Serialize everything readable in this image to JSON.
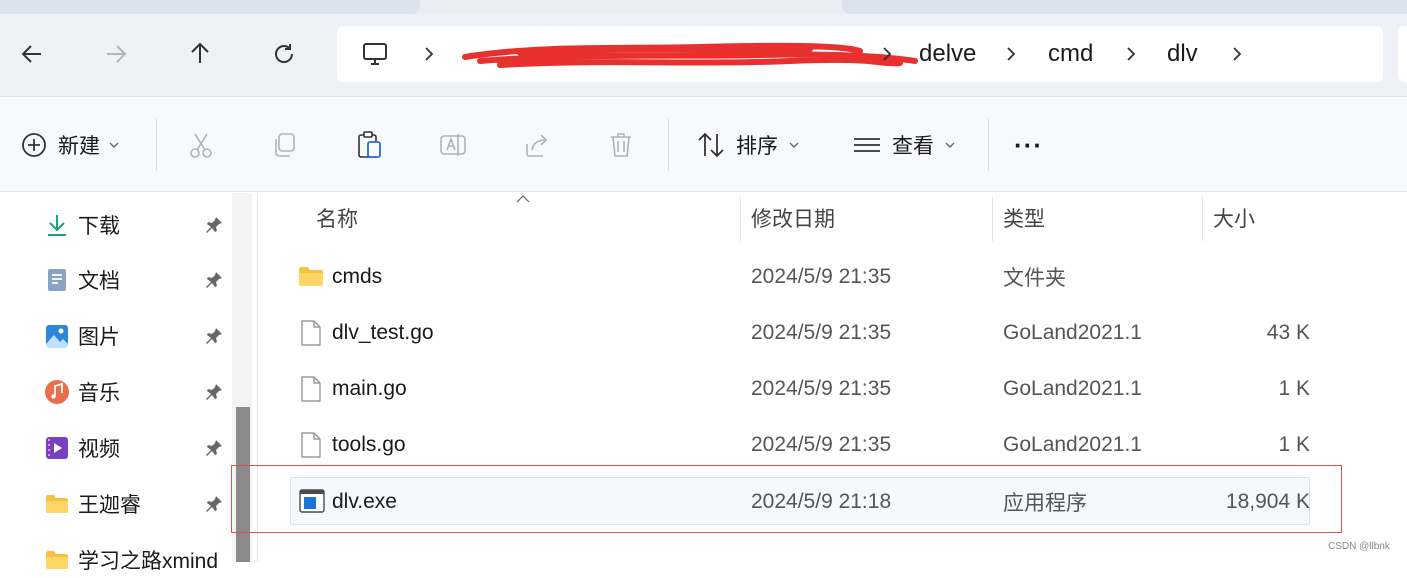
{
  "nav": {
    "back_icon": "arrow-left-icon",
    "forward_icon": "arrow-right-icon",
    "up_icon": "arrow-up-icon",
    "refresh_icon": "refresh-icon",
    "computer_icon": "monitor-icon",
    "ellipsis": "···",
    "breadcrumbs": [
      "delve",
      "cmd",
      "dlv"
    ]
  },
  "commands": {
    "new_label": "新建",
    "sort_label": "排序",
    "view_label": "查看",
    "more_label": "···"
  },
  "sidebar": {
    "items": [
      {
        "label": "下载",
        "icon": "download-icon"
      },
      {
        "label": "文档",
        "icon": "document-icon"
      },
      {
        "label": "图片",
        "icon": "picture-icon"
      },
      {
        "label": "音乐",
        "icon": "music-icon"
      },
      {
        "label": "视频",
        "icon": "video-icon"
      },
      {
        "label": "王迦睿",
        "icon": "folder-icon"
      },
      {
        "label": "学习之路xmind",
        "icon": "folder-icon"
      }
    ]
  },
  "columns": {
    "name": "名称",
    "modified": "修改日期",
    "type": "类型",
    "size": "大小"
  },
  "files": [
    {
      "name": "cmds",
      "modified": "2024/5/9 21:35",
      "type": "文件夹",
      "size": "",
      "icon": "folder-icon"
    },
    {
      "name": "dlv_test.go",
      "modified": "2024/5/9 21:35",
      "type": "GoLand2021.1",
      "size": "43 K",
      "icon": "file-icon"
    },
    {
      "name": "main.go",
      "modified": "2024/5/9 21:35",
      "type": "GoLand2021.1",
      "size": "1 K",
      "icon": "file-icon"
    },
    {
      "name": "tools.go",
      "modified": "2024/5/9 21:35",
      "type": "GoLand2021.1",
      "size": "1 K",
      "icon": "file-icon"
    },
    {
      "name": "dlv.exe",
      "modified": "2024/5/9 21:18",
      "type": "应用程序",
      "size": "18,904 K",
      "icon": "exe-icon"
    }
  ],
  "watermark": "CSDN @llbnk"
}
